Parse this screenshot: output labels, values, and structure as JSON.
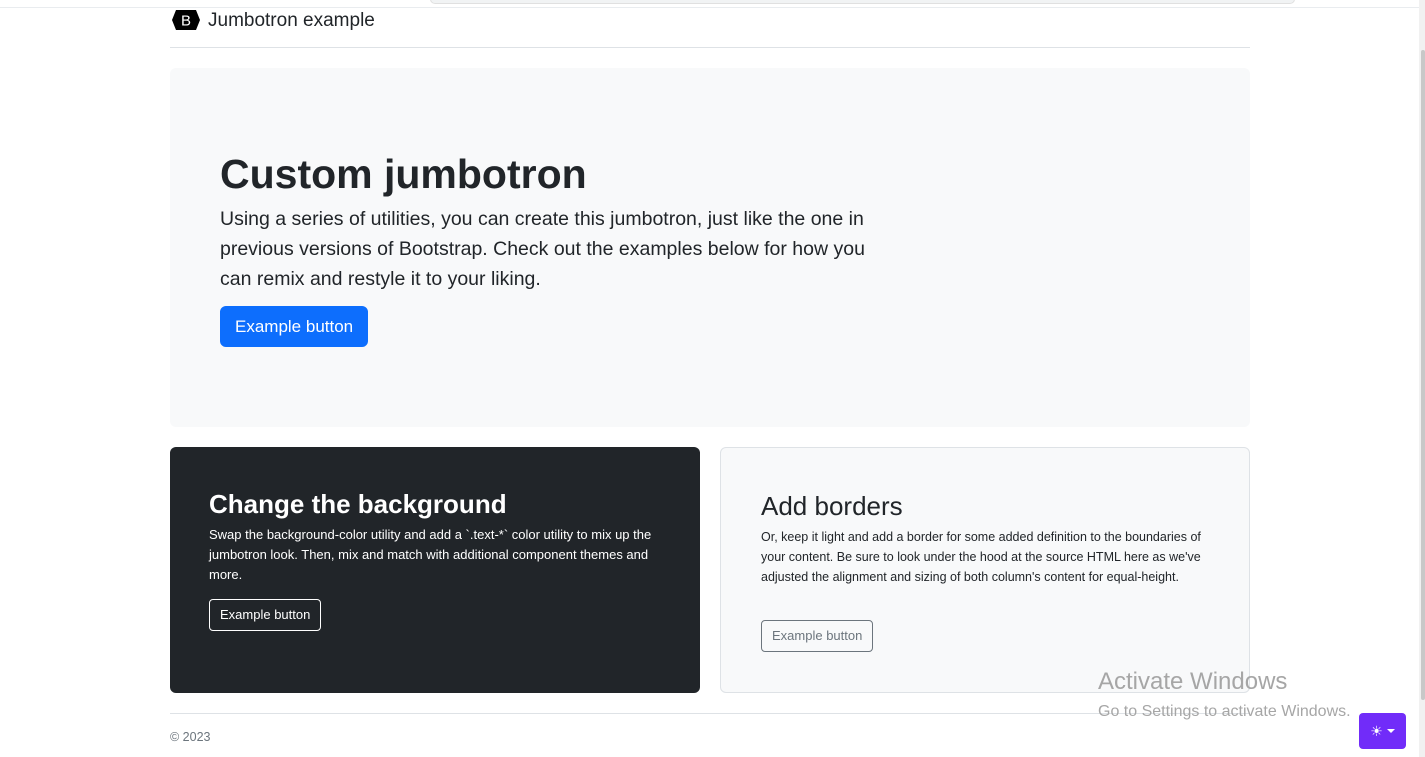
{
  "header": {
    "logo_letter": "B",
    "title": "Jumbotron example"
  },
  "jumbotron": {
    "heading": "Custom jumbotron",
    "text": "Using a series of utilities, you can create this jumbotron, just like the one in previous versions of Bootstrap. Check out the examples below for how you can remix and restyle it to your liking.",
    "button_label": "Example button"
  },
  "cards": {
    "dark": {
      "heading": "Change the background",
      "text": "Swap the background-color utility and add a `.text-*` color utility to mix up the jumbotron look. Then, mix and match with additional component themes and more.",
      "button_label": "Example button"
    },
    "light": {
      "heading": "Add borders",
      "text": "Or, keep it light and add a border for some added definition to the boundaries of your content. Be sure to look under the hood at the source HTML here as we've adjusted the alignment and sizing of both column's content for equal-height.",
      "button_label": "Example button"
    }
  },
  "footer": {
    "copyright": "© 2023"
  },
  "watermark": {
    "line1": "Activate Windows",
    "line2": "Go to Settings to activate Windows."
  },
  "theme_toggle": {
    "icon": "sun-icon",
    "color": "#712cf9"
  },
  "colors": {
    "primary": "#0d6efd",
    "dark_bg": "#212529",
    "light_bg": "#f8f9fa"
  }
}
